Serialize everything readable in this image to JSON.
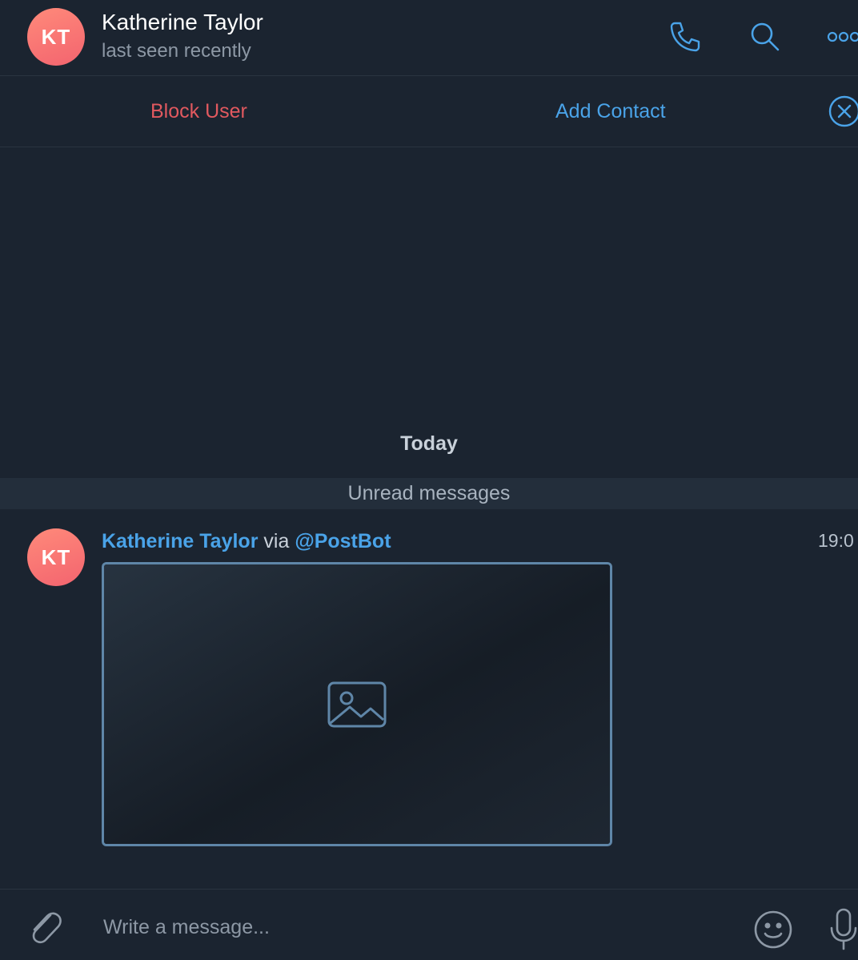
{
  "header": {
    "avatar_initials": "KT",
    "contact_name": "Katherine Taylor",
    "status": "last seen recently",
    "icons": [
      "phone-icon",
      "search-icon",
      "more-icon"
    ]
  },
  "action_bar": {
    "block_label": "Block User",
    "add_label": "Add Contact",
    "close_icon": "close-circle-icon"
  },
  "chat": {
    "date_label": "Today",
    "unread_label": "Unread messages",
    "message": {
      "avatar_initials": "KT",
      "sender": "Katherine Taylor",
      "via": "via",
      "bot": "@PostBot",
      "time": "19:0",
      "media": "image-placeholder"
    }
  },
  "composer": {
    "placeholder": "Write a message...",
    "icons": [
      "paperclip-icon",
      "emoji-icon",
      "microphone-icon"
    ]
  },
  "colors": {
    "background": "#1b2430",
    "accent": "#4aa3e8",
    "danger": "#e1595f",
    "muted": "#8d98a5",
    "avatar_gradient": [
      "#ff8a7a",
      "#f3646f"
    ]
  }
}
